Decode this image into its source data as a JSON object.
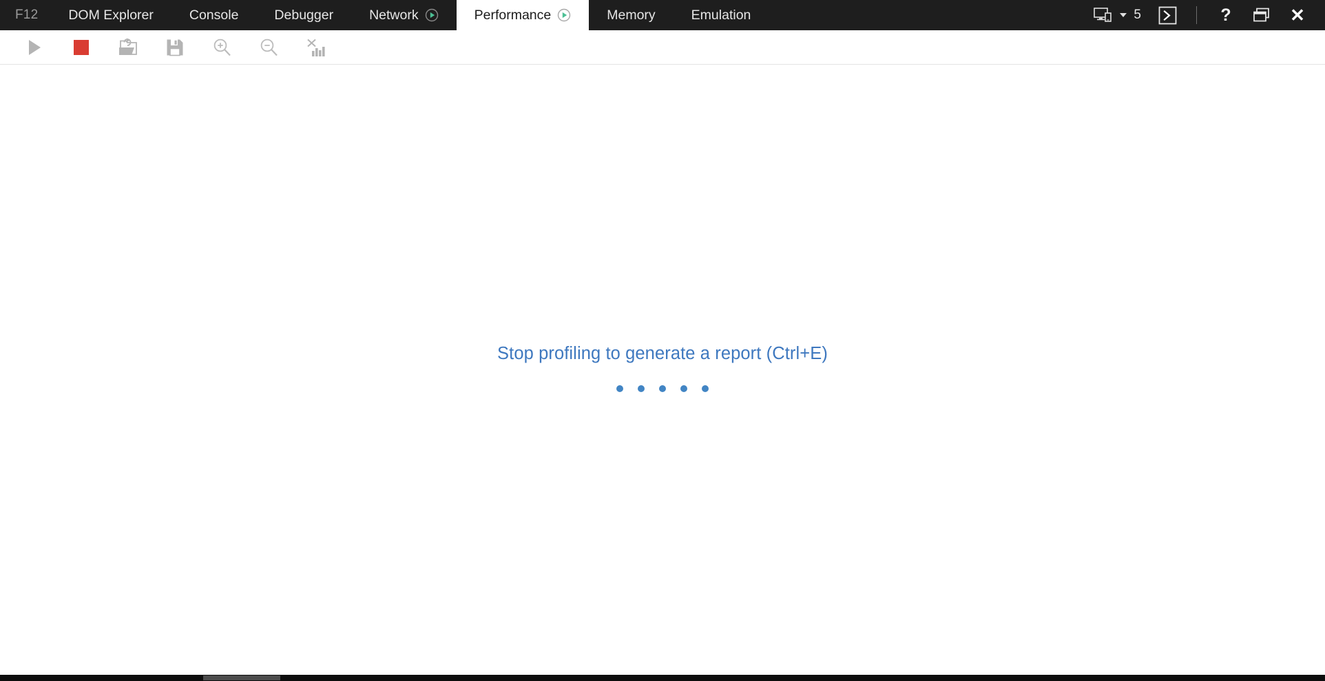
{
  "titlebar": {
    "f12_label": "F12",
    "tabs": [
      {
        "label": "DOM Explorer",
        "active": false,
        "recording": false,
        "name": "tab-dom-explorer"
      },
      {
        "label": "Console",
        "active": false,
        "recording": false,
        "name": "tab-console"
      },
      {
        "label": "Debugger",
        "active": false,
        "recording": false,
        "name": "tab-debugger"
      },
      {
        "label": "Network",
        "active": false,
        "recording": true,
        "name": "tab-network"
      },
      {
        "label": "Performance",
        "active": true,
        "recording": true,
        "name": "tab-performance"
      },
      {
        "label": "Memory",
        "active": false,
        "recording": false,
        "name": "tab-memory"
      },
      {
        "label": "Emulation",
        "active": false,
        "recording": false,
        "name": "tab-emulation"
      }
    ],
    "device_emulation_icon": "device-monitor-icon",
    "device_dropdown_icon": "chevron-down-icon",
    "device_count": "5",
    "console_drawer_icon": "console-prompt-icon",
    "help_label": "?",
    "help_icon": "help-icon",
    "dock_icon": "dock-window-icon",
    "close_label": "✕",
    "close_icon": "close-icon"
  },
  "toolbar": {
    "buttons": [
      {
        "name": "start-profiling-button",
        "icon": "play-icon",
        "label": "Start profiling",
        "enabled": false
      },
      {
        "name": "stop-profiling-button",
        "icon": "stop-icon",
        "label": "Stop profiling",
        "enabled": true
      },
      {
        "name": "open-profile-button",
        "icon": "open-folder-icon",
        "label": "Open profile",
        "enabled": true
      },
      {
        "name": "save-profile-button",
        "icon": "save-floppy-icon",
        "label": "Save profile",
        "enabled": true
      },
      {
        "name": "zoom-in-button",
        "icon": "zoom-in-icon",
        "label": "Zoom in",
        "enabled": true
      },
      {
        "name": "zoom-out-button",
        "icon": "zoom-out-icon",
        "label": "Zoom out",
        "enabled": true
      },
      {
        "name": "clear-chart-button",
        "icon": "clear-chart-icon",
        "label": "Clear chart",
        "enabled": true
      }
    ]
  },
  "main": {
    "empty_message": "Stop profiling to generate a report (Ctrl+E)",
    "loading_dots": 5
  },
  "colors": {
    "titlebar_bg": "#1e1e1e",
    "active_tab_bg": "#ffffff",
    "record_green": "#4cbf94",
    "stop_red": "#d93c32",
    "message_blue": "#3e78bf",
    "dot_blue": "#4285c4",
    "toolbar_icon_gray": "#b4b4b4",
    "bottom_bar": "#0d0d0d",
    "bottom_thumb": "#4c4c4c"
  }
}
